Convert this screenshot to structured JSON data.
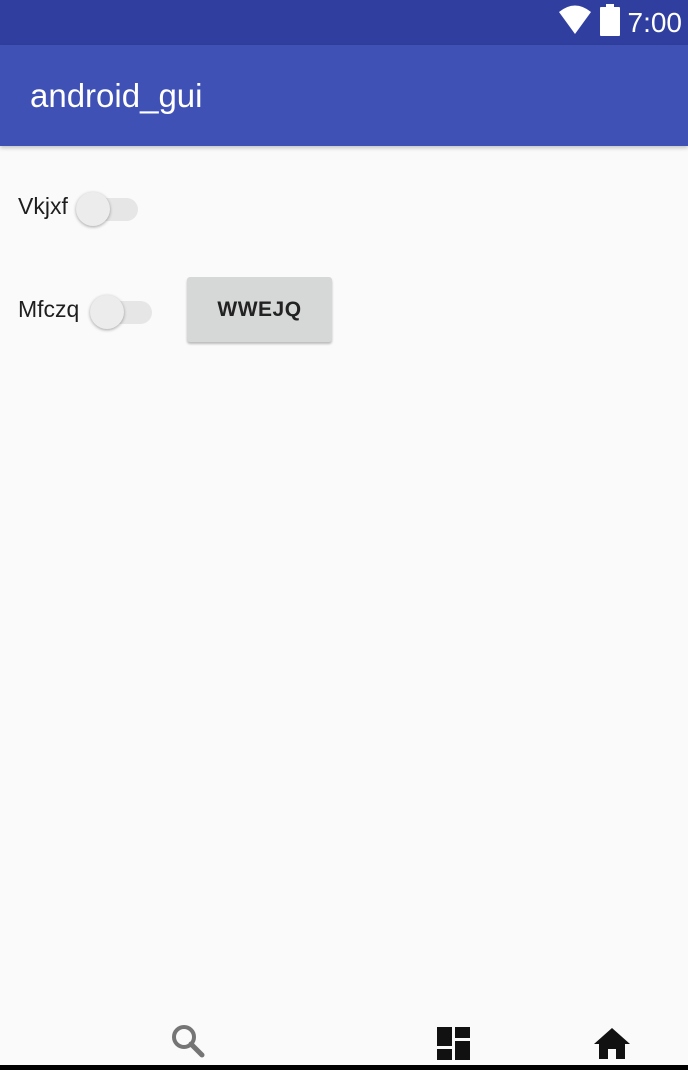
{
  "status_bar": {
    "time": "7:00",
    "icons": [
      "wifi-icon",
      "battery-icon"
    ],
    "background": "#303f9f"
  },
  "app_bar": {
    "title": "android_gui",
    "background": "#3f51b5"
  },
  "rows": [
    {
      "switch_label": "Vkjxf",
      "checked": false
    },
    {
      "switch_label": "Mfczq",
      "checked": false
    }
  ],
  "button": {
    "label": "WWEJQ"
  },
  "nav_bar": {
    "icons": [
      "search-icon",
      "dashboard-icon",
      "home-icon"
    ]
  }
}
